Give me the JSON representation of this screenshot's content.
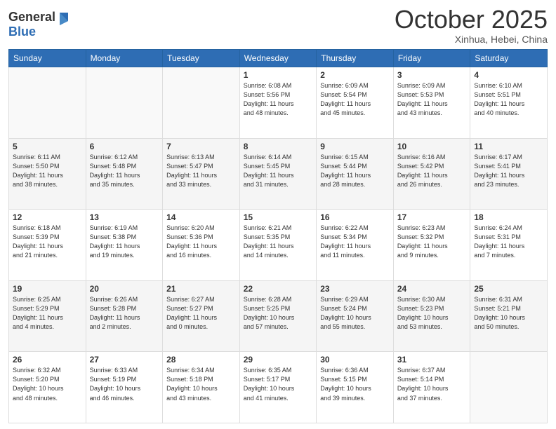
{
  "header": {
    "logo_general": "General",
    "logo_blue": "Blue",
    "month": "October 2025",
    "location": "Xinhua, Hebei, China"
  },
  "days_of_week": [
    "Sunday",
    "Monday",
    "Tuesday",
    "Wednesday",
    "Thursday",
    "Friday",
    "Saturday"
  ],
  "weeks": [
    [
      {
        "day": "",
        "info": ""
      },
      {
        "day": "",
        "info": ""
      },
      {
        "day": "",
        "info": ""
      },
      {
        "day": "1",
        "info": "Sunrise: 6:08 AM\nSunset: 5:56 PM\nDaylight: 11 hours\nand 48 minutes."
      },
      {
        "day": "2",
        "info": "Sunrise: 6:09 AM\nSunset: 5:54 PM\nDaylight: 11 hours\nand 45 minutes."
      },
      {
        "day": "3",
        "info": "Sunrise: 6:09 AM\nSunset: 5:53 PM\nDaylight: 11 hours\nand 43 minutes."
      },
      {
        "day": "4",
        "info": "Sunrise: 6:10 AM\nSunset: 5:51 PM\nDaylight: 11 hours\nand 40 minutes."
      }
    ],
    [
      {
        "day": "5",
        "info": "Sunrise: 6:11 AM\nSunset: 5:50 PM\nDaylight: 11 hours\nand 38 minutes."
      },
      {
        "day": "6",
        "info": "Sunrise: 6:12 AM\nSunset: 5:48 PM\nDaylight: 11 hours\nand 35 minutes."
      },
      {
        "day": "7",
        "info": "Sunrise: 6:13 AM\nSunset: 5:47 PM\nDaylight: 11 hours\nand 33 minutes."
      },
      {
        "day": "8",
        "info": "Sunrise: 6:14 AM\nSunset: 5:45 PM\nDaylight: 11 hours\nand 31 minutes."
      },
      {
        "day": "9",
        "info": "Sunrise: 6:15 AM\nSunset: 5:44 PM\nDaylight: 11 hours\nand 28 minutes."
      },
      {
        "day": "10",
        "info": "Sunrise: 6:16 AM\nSunset: 5:42 PM\nDaylight: 11 hours\nand 26 minutes."
      },
      {
        "day": "11",
        "info": "Sunrise: 6:17 AM\nSunset: 5:41 PM\nDaylight: 11 hours\nand 23 minutes."
      }
    ],
    [
      {
        "day": "12",
        "info": "Sunrise: 6:18 AM\nSunset: 5:39 PM\nDaylight: 11 hours\nand 21 minutes."
      },
      {
        "day": "13",
        "info": "Sunrise: 6:19 AM\nSunset: 5:38 PM\nDaylight: 11 hours\nand 19 minutes."
      },
      {
        "day": "14",
        "info": "Sunrise: 6:20 AM\nSunset: 5:36 PM\nDaylight: 11 hours\nand 16 minutes."
      },
      {
        "day": "15",
        "info": "Sunrise: 6:21 AM\nSunset: 5:35 PM\nDaylight: 11 hours\nand 14 minutes."
      },
      {
        "day": "16",
        "info": "Sunrise: 6:22 AM\nSunset: 5:34 PM\nDaylight: 11 hours\nand 11 minutes."
      },
      {
        "day": "17",
        "info": "Sunrise: 6:23 AM\nSunset: 5:32 PM\nDaylight: 11 hours\nand 9 minutes."
      },
      {
        "day": "18",
        "info": "Sunrise: 6:24 AM\nSunset: 5:31 PM\nDaylight: 11 hours\nand 7 minutes."
      }
    ],
    [
      {
        "day": "19",
        "info": "Sunrise: 6:25 AM\nSunset: 5:29 PM\nDaylight: 11 hours\nand 4 minutes."
      },
      {
        "day": "20",
        "info": "Sunrise: 6:26 AM\nSunset: 5:28 PM\nDaylight: 11 hours\nand 2 minutes."
      },
      {
        "day": "21",
        "info": "Sunrise: 6:27 AM\nSunset: 5:27 PM\nDaylight: 11 hours\nand 0 minutes."
      },
      {
        "day": "22",
        "info": "Sunrise: 6:28 AM\nSunset: 5:25 PM\nDaylight: 10 hours\nand 57 minutes."
      },
      {
        "day": "23",
        "info": "Sunrise: 6:29 AM\nSunset: 5:24 PM\nDaylight: 10 hours\nand 55 minutes."
      },
      {
        "day": "24",
        "info": "Sunrise: 6:30 AM\nSunset: 5:23 PM\nDaylight: 10 hours\nand 53 minutes."
      },
      {
        "day": "25",
        "info": "Sunrise: 6:31 AM\nSunset: 5:21 PM\nDaylight: 10 hours\nand 50 minutes."
      }
    ],
    [
      {
        "day": "26",
        "info": "Sunrise: 6:32 AM\nSunset: 5:20 PM\nDaylight: 10 hours\nand 48 minutes."
      },
      {
        "day": "27",
        "info": "Sunrise: 6:33 AM\nSunset: 5:19 PM\nDaylight: 10 hours\nand 46 minutes."
      },
      {
        "day": "28",
        "info": "Sunrise: 6:34 AM\nSunset: 5:18 PM\nDaylight: 10 hours\nand 43 minutes."
      },
      {
        "day": "29",
        "info": "Sunrise: 6:35 AM\nSunset: 5:17 PM\nDaylight: 10 hours\nand 41 minutes."
      },
      {
        "day": "30",
        "info": "Sunrise: 6:36 AM\nSunset: 5:15 PM\nDaylight: 10 hours\nand 39 minutes."
      },
      {
        "day": "31",
        "info": "Sunrise: 6:37 AM\nSunset: 5:14 PM\nDaylight: 10 hours\nand 37 minutes."
      },
      {
        "day": "",
        "info": ""
      }
    ]
  ]
}
